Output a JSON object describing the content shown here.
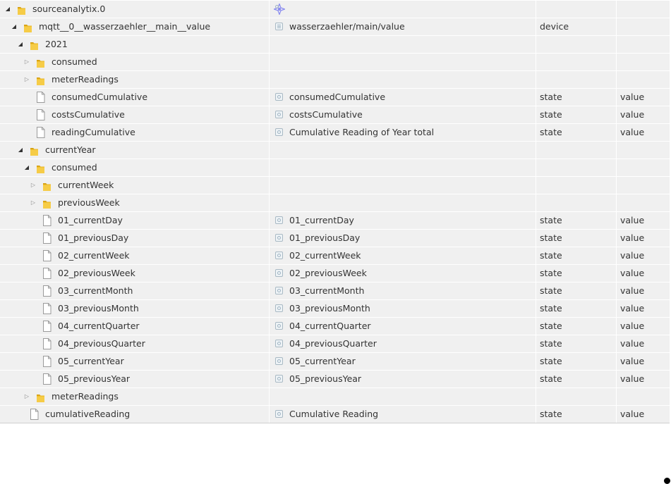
{
  "columns": [
    "name",
    "label",
    "type",
    "role"
  ],
  "rows": [
    {
      "level": 0,
      "kind": "folder",
      "toggle": "open",
      "name": "sourceanalytix.0",
      "label": "",
      "type": "",
      "role": "",
      "labelIcon": "adapter-icon"
    },
    {
      "level": 1,
      "kind": "folder",
      "toggle": "open",
      "name": "mqtt__0__wasserzaehler__main__value",
      "label": "wasserzaehler/main/value",
      "type": "device",
      "role": "",
      "labelIcon": "device-icon"
    },
    {
      "level": 2,
      "kind": "folder",
      "toggle": "open",
      "name": "2021",
      "label": "",
      "type": "",
      "role": ""
    },
    {
      "level": 3,
      "kind": "folder",
      "toggle": "closed",
      "name": "consumed",
      "label": "",
      "type": "",
      "role": ""
    },
    {
      "level": 3,
      "kind": "folder",
      "toggle": "closed",
      "name": "meterReadings",
      "label": "",
      "type": "",
      "role": ""
    },
    {
      "level": 3,
      "kind": "file",
      "toggle": "none",
      "name": "consumedCumulative",
      "label": "consumedCumulative",
      "type": "state",
      "role": "value",
      "labelIcon": "state-icon"
    },
    {
      "level": 3,
      "kind": "file",
      "toggle": "none",
      "name": "costsCumulative",
      "label": "costsCumulative",
      "type": "state",
      "role": "value",
      "labelIcon": "state-icon"
    },
    {
      "level": 3,
      "kind": "file",
      "toggle": "none",
      "name": "readingCumulative",
      "label": "Cumulative Reading of Year total",
      "type": "state",
      "role": "value",
      "labelIcon": "state-icon"
    },
    {
      "level": 2,
      "kind": "folder",
      "toggle": "open",
      "name": "currentYear",
      "label": "",
      "type": "",
      "role": ""
    },
    {
      "level": 3,
      "kind": "folder",
      "toggle": "open",
      "name": "consumed",
      "label": "",
      "type": "",
      "role": ""
    },
    {
      "level": 4,
      "kind": "folder",
      "toggle": "closed",
      "name": "currentWeek",
      "label": "",
      "type": "",
      "role": ""
    },
    {
      "level": 4,
      "kind": "folder",
      "toggle": "closed",
      "name": "previousWeek",
      "label": "",
      "type": "",
      "role": ""
    },
    {
      "level": 4,
      "kind": "file",
      "toggle": "none",
      "name": "01_currentDay",
      "label": "01_currentDay",
      "type": "state",
      "role": "value",
      "labelIcon": "state-icon"
    },
    {
      "level": 4,
      "kind": "file",
      "toggle": "none",
      "name": "01_previousDay",
      "label": "01_previousDay",
      "type": "state",
      "role": "value",
      "labelIcon": "state-icon"
    },
    {
      "level": 4,
      "kind": "file",
      "toggle": "none",
      "name": "02_currentWeek",
      "label": "02_currentWeek",
      "type": "state",
      "role": "value",
      "labelIcon": "state-icon"
    },
    {
      "level": 4,
      "kind": "file",
      "toggle": "none",
      "name": "02_previousWeek",
      "label": "02_previousWeek",
      "type": "state",
      "role": "value",
      "labelIcon": "state-icon"
    },
    {
      "level": 4,
      "kind": "file",
      "toggle": "none",
      "name": "03_currentMonth",
      "label": "03_currentMonth",
      "type": "state",
      "role": "value",
      "labelIcon": "state-icon"
    },
    {
      "level": 4,
      "kind": "file",
      "toggle": "none",
      "name": "03_previousMonth",
      "label": "03_previousMonth",
      "type": "state",
      "role": "value",
      "labelIcon": "state-icon"
    },
    {
      "level": 4,
      "kind": "file",
      "toggle": "none",
      "name": "04_currentQuarter",
      "label": "04_currentQuarter",
      "type": "state",
      "role": "value",
      "labelIcon": "state-icon"
    },
    {
      "level": 4,
      "kind": "file",
      "toggle": "none",
      "name": "04_previousQuarter",
      "label": "04_previousQuarter",
      "type": "state",
      "role": "value",
      "labelIcon": "state-icon"
    },
    {
      "level": 4,
      "kind": "file",
      "toggle": "none",
      "name": "05_currentYear",
      "label": "05_currentYear",
      "type": "state",
      "role": "value",
      "labelIcon": "state-icon"
    },
    {
      "level": 4,
      "kind": "file",
      "toggle": "none",
      "name": "05_previousYear",
      "label": "05_previousYear",
      "type": "state",
      "role": "value",
      "labelIcon": "state-icon"
    },
    {
      "level": 3,
      "kind": "folder",
      "toggle": "closed",
      "name": "meterReadings",
      "label": "",
      "type": "",
      "role": ""
    },
    {
      "level": 2,
      "kind": "file",
      "toggle": "none",
      "name": "cumulativeReading",
      "label": "Cumulative Reading",
      "type": "state",
      "role": "value",
      "labelIcon": "state-icon"
    }
  ],
  "colors": {
    "row_bg": "#f0f0f0",
    "folder": "#f0c232",
    "adapter_icon": "#8a8cf0"
  }
}
